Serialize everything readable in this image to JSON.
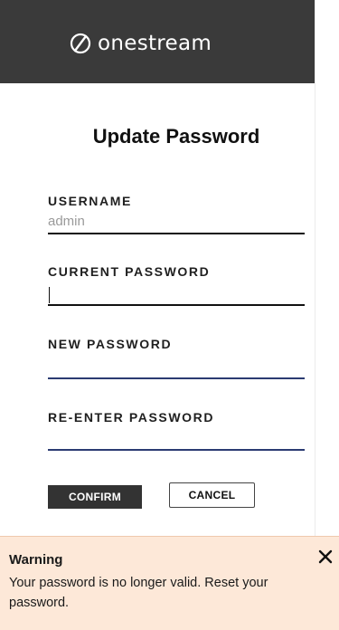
{
  "header": {
    "logo_text": "onestream"
  },
  "form": {
    "title": "Update Password",
    "username_label": "USERNAME",
    "username_value": "admin",
    "current_password_label": "CURRENT PASSWORD",
    "current_password_value": "",
    "new_password_label": "NEW PASSWORD",
    "new_password_value": "",
    "reenter_password_label": "RE-ENTER PASSWORD",
    "reenter_password_value": "",
    "confirm_label": "CONFIRM",
    "cancel_label": "CANCEL"
  },
  "warning": {
    "title": "Warning",
    "message": "Your password is no longer valid. Reset your password.",
    "close_icon": "close-icon"
  },
  "colors": {
    "header_bg": "#3a3a3a",
    "warning_bg": "#fde8d8",
    "input_underline_active": "#2b3b72",
    "confirm_bg": "#333333"
  }
}
